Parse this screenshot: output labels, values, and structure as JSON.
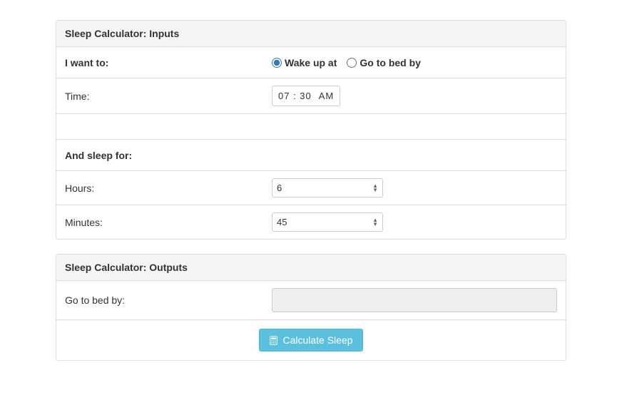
{
  "inputs_panel": {
    "title": "Sleep Calculator: Inputs",
    "i_want_to_label": "I want to:",
    "radio_wake": "Wake up at",
    "radio_bed": "Go to bed by",
    "time_label": "Time:",
    "time_value": "07 : 30",
    "time_period": "AM",
    "sleep_for_label": "And sleep for:",
    "hours_label": "Hours:",
    "hours_value": "6",
    "minutes_label": "Minutes:",
    "minutes_value": "45"
  },
  "outputs_panel": {
    "title": "Sleep Calculator: Outputs",
    "output_label": "Go to bed by:",
    "output_value": "",
    "button_label": "Calculate Sleep"
  }
}
